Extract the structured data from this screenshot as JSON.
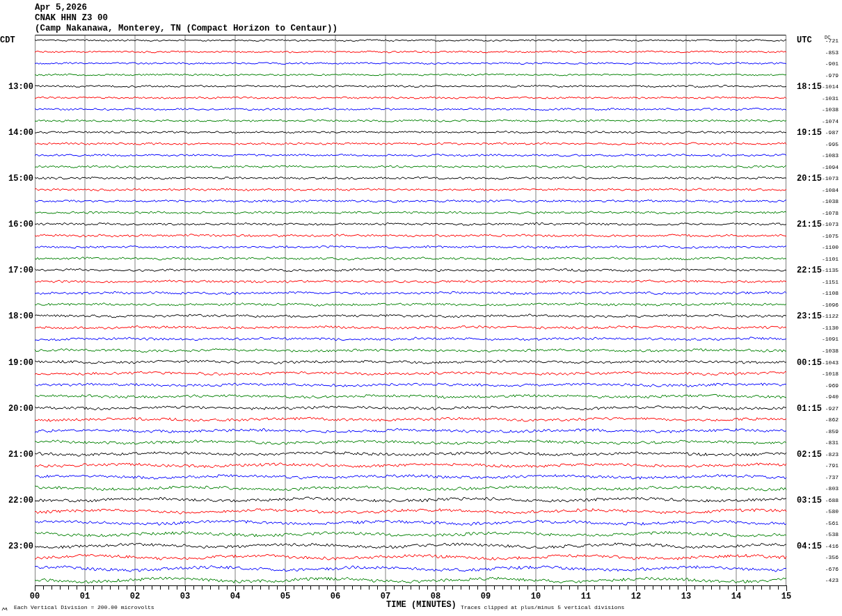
{
  "header": {
    "date": "Apr 5,2026",
    "station": "CNAK HHN Z3 00",
    "location": "(Camp Nakanawa, Monterey, TN (Compact Horizon to Centaur))"
  },
  "local_zone": "CDT",
  "utc_zone": "UTC",
  "dc_label": "DC",
  "rows": [
    {
      "color": "#000000",
      "dc": "-721"
    },
    {
      "color": "#ff0000",
      "dc": "-853"
    },
    {
      "color": "#0000ff",
      "dc": "-901"
    },
    {
      "color": "#008000",
      "dc": "-979"
    },
    {
      "color": "#000000",
      "dc": "-1014",
      "local_time": "13:00",
      "utc_time": "18:15"
    },
    {
      "color": "#ff0000",
      "dc": "-1031"
    },
    {
      "color": "#0000ff",
      "dc": "-1038"
    },
    {
      "color": "#008000",
      "dc": "-1074"
    },
    {
      "color": "#000000",
      "dc": "-987",
      "local_time": "14:00",
      "utc_time": "19:15"
    },
    {
      "color": "#ff0000",
      "dc": "-995"
    },
    {
      "color": "#0000ff",
      "dc": "-1083"
    },
    {
      "color": "#008000",
      "dc": "-1094"
    },
    {
      "color": "#000000",
      "dc": "-1073",
      "local_time": "15:00",
      "utc_time": "20:15"
    },
    {
      "color": "#ff0000",
      "dc": "-1084"
    },
    {
      "color": "#0000ff",
      "dc": "-1038"
    },
    {
      "color": "#008000",
      "dc": "-1078"
    },
    {
      "color": "#000000",
      "dc": "-1073",
      "local_time": "16:00",
      "utc_time": "21:15"
    },
    {
      "color": "#ff0000",
      "dc": "-1075"
    },
    {
      "color": "#0000ff",
      "dc": "-1100"
    },
    {
      "color": "#008000",
      "dc": "-1101"
    },
    {
      "color": "#000000",
      "dc": "-1135",
      "local_time": "17:00",
      "utc_time": "22:15"
    },
    {
      "color": "#ff0000",
      "dc": "-1151"
    },
    {
      "color": "#0000ff",
      "dc": "-1108"
    },
    {
      "color": "#008000",
      "dc": "-1096"
    },
    {
      "color": "#000000",
      "dc": "-1122",
      "local_time": "18:00",
      "utc_time": "23:15"
    },
    {
      "color": "#ff0000",
      "dc": "-1130"
    },
    {
      "color": "#0000ff",
      "dc": "-1091"
    },
    {
      "color": "#008000",
      "dc": "-1038"
    },
    {
      "color": "#000000",
      "dc": "-1043",
      "local_time": "19:00",
      "utc_time": "00:15"
    },
    {
      "color": "#ff0000",
      "dc": "-1018"
    },
    {
      "color": "#0000ff",
      "dc": "-969"
    },
    {
      "color": "#008000",
      "dc": "-940"
    },
    {
      "color": "#000000",
      "dc": "-927",
      "local_time": "20:00",
      "utc_time": "01:15"
    },
    {
      "color": "#ff0000",
      "dc": "-862"
    },
    {
      "color": "#0000ff",
      "dc": "-859"
    },
    {
      "color": "#008000",
      "dc": "-831"
    },
    {
      "color": "#000000",
      "dc": "-823",
      "local_time": "21:00",
      "utc_time": "02:15"
    },
    {
      "color": "#ff0000",
      "dc": "-791"
    },
    {
      "color": "#0000ff",
      "dc": "-737"
    },
    {
      "color": "#008000",
      "dc": "-803"
    },
    {
      "color": "#000000",
      "dc": "-688",
      "local_time": "22:00",
      "utc_time": "03:15"
    },
    {
      "color": "#ff0000",
      "dc": "-580"
    },
    {
      "color": "#0000ff",
      "dc": "-561"
    },
    {
      "color": "#008000",
      "dc": "-538"
    },
    {
      "color": "#000000",
      "dc": "-416",
      "local_time": "23:00",
      "utc_time": "04:15"
    },
    {
      "color": "#ff0000",
      "dc": "-356"
    },
    {
      "color": "#0000ff",
      "dc": "-676"
    },
    {
      "color": "#008000",
      "dc": "-423"
    }
  ],
  "x_ticks": [
    "00",
    "01",
    "02",
    "03",
    "04",
    "05",
    "06",
    "07",
    "08",
    "09",
    "10",
    "11",
    "12",
    "13",
    "14",
    "15"
  ],
  "x_title": "TIME (MINUTES)",
  "scale_note": "Each Vertical Division =  200.00 microvolts",
  "clip_note": "Traces clipped at plus/minus 5 vertical divisions"
}
